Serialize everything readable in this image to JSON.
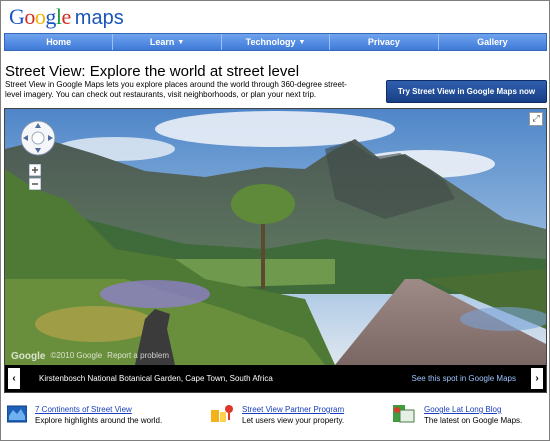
{
  "header": {
    "logo_text": "Google",
    "product": "maps"
  },
  "nav": {
    "items": [
      {
        "label": "Home",
        "caret": ""
      },
      {
        "label": "Learn",
        "caret": "▼"
      },
      {
        "label": "Technology",
        "caret": "▼"
      },
      {
        "label": "Privacy",
        "caret": ""
      },
      {
        "label": "Gallery",
        "caret": ""
      }
    ]
  },
  "intro": {
    "title": "Street View: Explore the world at street level",
    "description": "Street View in Google Maps lets you explore places around the world through 360-degree street-level imagery. You can check out restaurants, visit neighborhoods, or plan your next trip.",
    "cta_label": "Try Street View in Google Maps now"
  },
  "viewer": {
    "caption": "Kirstenbosch National Botanical Garden, Cape Town, South Africa",
    "link": "See this spot in Google Maps",
    "prev_glyph": "‹",
    "next_glyph": "›",
    "watermark_logo": "Google",
    "watermark_copy": "©2010 Google",
    "report": "Report a problem"
  },
  "features": [
    {
      "title": "7 Continents of Street View",
      "subtitle": "Explore highlights around the world.",
      "icon": "globe-map-icon"
    },
    {
      "title": "Street View Partner Program",
      "subtitle": "Let users view your property.",
      "icon": "partner-pins-icon"
    },
    {
      "title": "Google Lat Long Blog",
      "subtitle": "The latest on Google Maps.",
      "icon": "blog-map-icon"
    }
  ],
  "colors": {
    "nav_blue": "#4a86e0",
    "cta_blue": "#1f4a98",
    "link_blue": "#1a40bf"
  }
}
